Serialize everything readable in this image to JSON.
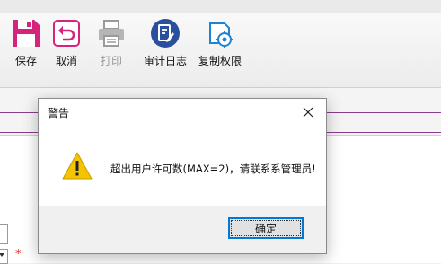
{
  "toolbar": {
    "buttons": [
      {
        "label": "保存",
        "icon": "save-icon",
        "enabled": true
      },
      {
        "label": "取消",
        "icon": "undo-icon",
        "enabled": true
      },
      {
        "label": "打印",
        "icon": "printer-icon",
        "enabled": false
      },
      {
        "label": "审计日志",
        "icon": "audit-log-icon",
        "enabled": true
      },
      {
        "label": "复制权限",
        "icon": "copy-permissions-icon",
        "enabled": true
      }
    ]
  },
  "form": {
    "required_marker": "*"
  },
  "dialog": {
    "title": "警告",
    "message": "超出用户许可数(MAX=2)，请联系系管理员!",
    "ok_label": "确定",
    "icon": "warning-icon"
  },
  "colors": {
    "save_magenta": "#d6247c",
    "audit_blue": "#2a4f9e",
    "copy_blue": "#1b84d6",
    "accent_line": "#8a3d8f",
    "warning_yellow": "#f5c400",
    "focus_blue": "#0078d7"
  }
}
